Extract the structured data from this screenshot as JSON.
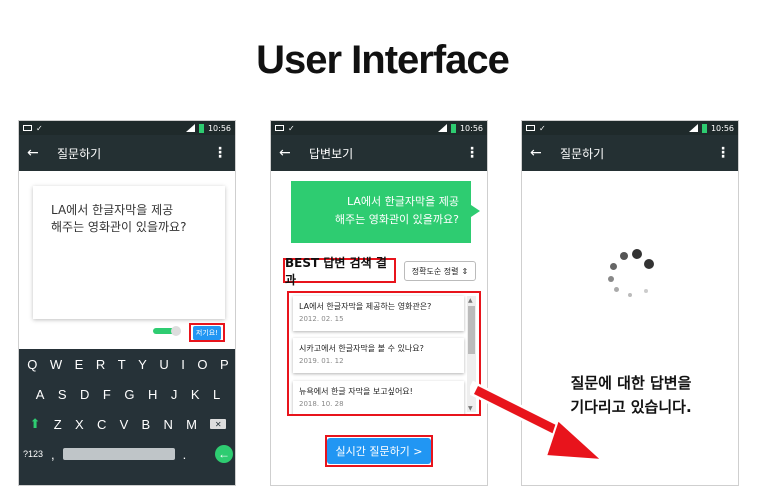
{
  "title": "User Interface",
  "status": {
    "time": "10:56"
  },
  "phone1": {
    "appbar_title": "질문하기",
    "question_line1": "LA에서 한글자막을 제공",
    "question_line2": "해주는 영화관이 있을까요?",
    "send_label": "저기요!",
    "keyboard": {
      "row1": [
        "Q",
        "W",
        "E",
        "R",
        "T",
        "Y",
        "U",
        "I",
        "O",
        "P"
      ],
      "row2": [
        "A",
        "S",
        "D",
        "F",
        "G",
        "H",
        "J",
        "K",
        "L"
      ],
      "row3": [
        "Z",
        "X",
        "C",
        "V",
        "B",
        "N",
        "M"
      ],
      "symbols_key": "?123",
      "comma_key": ",",
      "period_key": "."
    }
  },
  "phone2": {
    "appbar_title": "답변보기",
    "bubble_line1": "LA에서 한글자막을 제공",
    "bubble_line2": "해주는 영화관이 있을까요?",
    "best_label": "BEST 답변 검색 결과",
    "sort_label": "정확도순 정렬",
    "results": [
      {
        "title": "LA에서 한글자막을 제공하는 영화관은?",
        "date": "2012. 02. 15"
      },
      {
        "title": "시카고에서 한글자막을 볼 수 있나요?",
        "date": "2019. 01. 12"
      },
      {
        "title": "뉴욕에서 한글 자막을 보고싶어요!",
        "date": "2018. 10. 28"
      }
    ],
    "realtime_label": "실시간 질문하기 >"
  },
  "phone3": {
    "appbar_title": "질문하기",
    "wait_line1": "질문에 대한 답변을",
    "wait_line2": "기다리고 있습니다."
  },
  "colors": {
    "accent_green": "#2ecc71",
    "accent_blue": "#2196f3",
    "highlight_red": "#e8141c",
    "appbar_dark": "#243033"
  }
}
